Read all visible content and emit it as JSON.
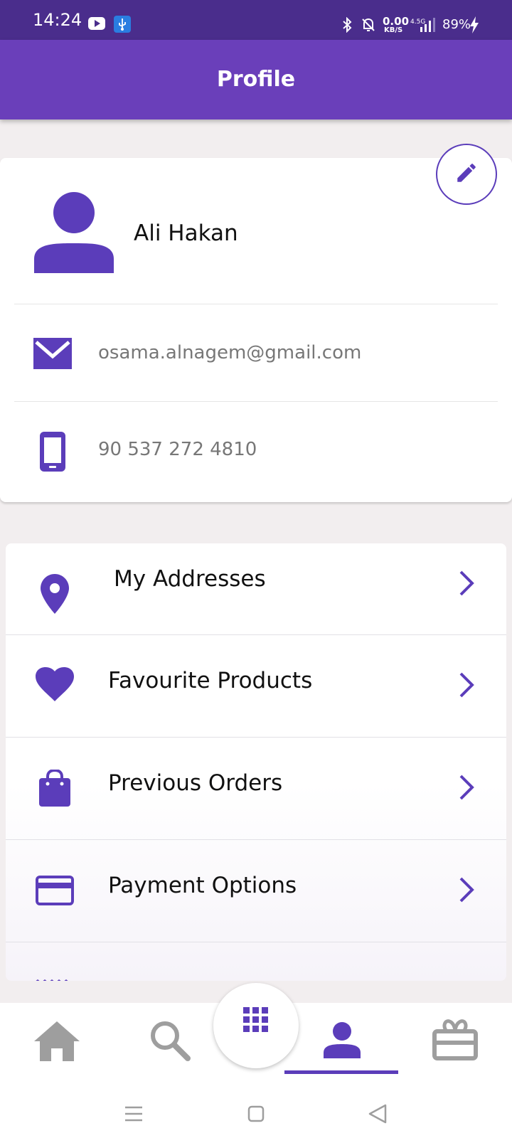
{
  "status_bar": {
    "time": "14:24",
    "net_speed_value": "0.00",
    "net_speed_unit": "KB/S",
    "net_type": "4.5G",
    "battery": "89%",
    "icons": [
      "youtube-icon",
      "usb-icon",
      "bluetooth-icon",
      "mute-icon",
      "signal-icon",
      "charging-icon"
    ]
  },
  "app_bar": {
    "title": "Profile"
  },
  "profile": {
    "name": "Ali Hakan",
    "email": "osama.alnagem@gmail.com",
    "phone": "90 537 272 4810",
    "icons": {
      "avatar": "person-icon",
      "email": "mail-icon",
      "phone": "phone-icon",
      "edit": "pencil-icon"
    }
  },
  "menu": {
    "items": [
      {
        "label": "My Addresses",
        "icon": "location-pin-icon"
      },
      {
        "label": "Favourite Products",
        "icon": "heart-icon"
      },
      {
        "label": "Previous Orders",
        "icon": "shopping-bag-icon"
      },
      {
        "label": "Payment Options",
        "icon": "credit-card-icon"
      }
    ]
  },
  "bottom_nav": {
    "items": [
      "home-icon",
      "search-icon",
      "grid-icon",
      "profile-icon",
      "gift-icon"
    ],
    "active": "profile-icon"
  },
  "colors": {
    "status_bar": "#4a2d8c",
    "app_bar": "#6a3fba",
    "accent": "#5b3dba",
    "background": "#f2eeef",
    "inactive_icon": "#9e9e9e"
  }
}
